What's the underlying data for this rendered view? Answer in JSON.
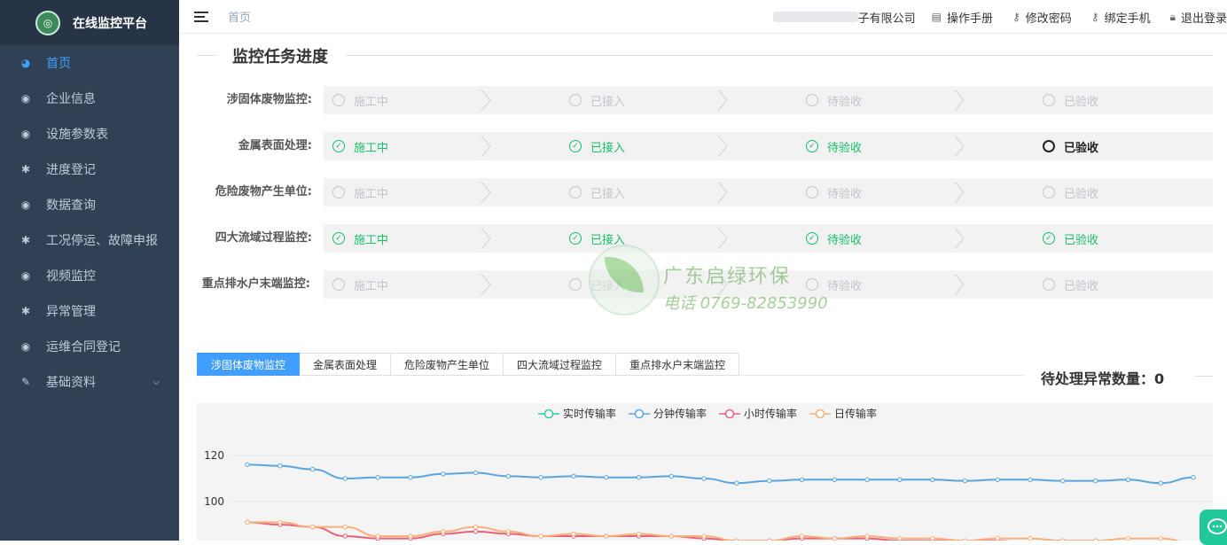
{
  "sidebar": {
    "logo_title": "在线监控平台",
    "items": [
      {
        "label": "首页",
        "icon": "dashboard-icon",
        "active": true
      },
      {
        "label": "企业信息",
        "icon": "eye-icon"
      },
      {
        "label": "设施参数表",
        "icon": "eye-icon"
      },
      {
        "label": "进度登记",
        "icon": "bug-icon"
      },
      {
        "label": "数据查询",
        "icon": "eye-icon"
      },
      {
        "label": "工况停运、故障申报",
        "icon": "bug-icon"
      },
      {
        "label": "视频监控",
        "icon": "eye-icon"
      },
      {
        "label": "异常管理",
        "icon": "bug-icon"
      },
      {
        "label": "运维合同登记",
        "icon": "eye-icon"
      },
      {
        "label": "基础资料",
        "icon": "edit-icon",
        "has_submenu": true
      }
    ]
  },
  "header": {
    "breadcrumb": "首页",
    "company": "子有限公司",
    "links": [
      "操作手册",
      "修改密码",
      "绑定手机",
      "退出登录"
    ]
  },
  "progress": {
    "title": "监控任务进度",
    "rows": [
      {
        "label": "涉固体废物监控:",
        "steps": [
          [
            "施工中",
            "pending"
          ],
          [
            "已接入",
            "pending"
          ],
          [
            "待验收",
            "pending"
          ],
          [
            "已验收",
            "pending"
          ]
        ]
      },
      {
        "label": "金属表面处理:",
        "steps": [
          [
            "施工中",
            "done"
          ],
          [
            "已接入",
            "done"
          ],
          [
            "待验收",
            "done"
          ],
          [
            "已验收",
            "current"
          ]
        ]
      },
      {
        "label": "危险废物产生单位:",
        "steps": [
          [
            "施工中",
            "pending"
          ],
          [
            "已接入",
            "pending"
          ],
          [
            "待验收",
            "pending"
          ],
          [
            "已验收",
            "pending"
          ]
        ]
      },
      {
        "label": "四大流域过程监控:",
        "steps": [
          [
            "施工中",
            "done"
          ],
          [
            "已接入",
            "done"
          ],
          [
            "待验收",
            "done"
          ],
          [
            "已验收",
            "done"
          ]
        ]
      },
      {
        "label": "重点排水户末端监控:",
        "steps": [
          [
            "施工中",
            "pending"
          ],
          [
            "已接入",
            "pending"
          ],
          [
            "待验收",
            "pending"
          ],
          [
            "已验收",
            "pending"
          ]
        ]
      }
    ]
  },
  "watermark": {
    "name": "广东启绿环保",
    "phone": "电话 0769-82853990"
  },
  "tabs": [
    "涉固体废物监控",
    "金属表面处理",
    "危险废物产生单位",
    "四大流域过程监控",
    "重点排水户末端监控"
  ],
  "active_tab": 0,
  "pending_count_label": "待处理异常数量：0",
  "colors": {
    "accent": "#409eff",
    "done": "#19be6b",
    "sidebar": "#304156"
  },
  "chart_data": {
    "type": "line",
    "legend": [
      "实时传输率",
      "分钟传输率",
      "小时传输率",
      "日传输率"
    ],
    "series_colors": [
      "#3dc5a9",
      "#5aa5e0",
      "#e8637a",
      "#f7b07a"
    ],
    "yticks": [
      100,
      120
    ],
    "y_visible_range": [
      82,
      130
    ],
    "series": [
      {
        "name": "分钟传输率",
        "values": [
          116,
          115.5,
          114,
          110,
          110.5,
          110.5,
          112,
          112.5,
          111,
          110.5,
          111,
          110.5,
          110.5,
          111,
          110,
          108,
          109,
          109.5,
          109.5,
          109.5,
          109.5,
          109.5,
          109,
          109.5,
          109.5,
          109,
          109,
          109.5,
          108,
          110.5
        ]
      },
      {
        "name": "小时传输率",
        "values": [
          91,
          90,
          89,
          85,
          84,
          84,
          86,
          87,
          86,
          85,
          85,
          85,
          85,
          85,
          84,
          83,
          83,
          84,
          84,
          84,
          83,
          83,
          83,
          83,
          82,
          83,
          83,
          82,
          82,
          81
        ]
      },
      {
        "name": "日传输率",
        "values": [
          91,
          91,
          89,
          89,
          85,
          85,
          87,
          89,
          87,
          85,
          86,
          85,
          86,
          85,
          85,
          83,
          83,
          85,
          84,
          85,
          84,
          84,
          83,
          84,
          84,
          83,
          83,
          84,
          84,
          82
        ]
      }
    ]
  }
}
